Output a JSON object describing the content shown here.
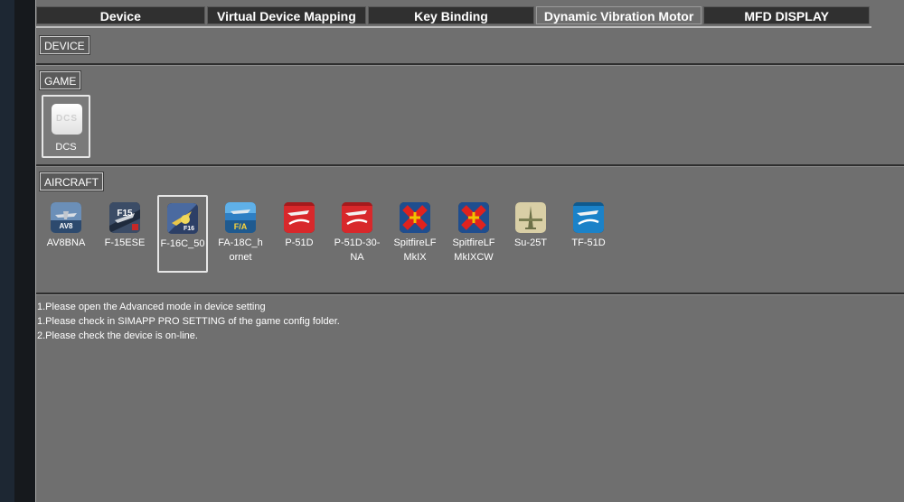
{
  "tabs": [
    {
      "label": "Device",
      "active": false
    },
    {
      "label": "Virtual Device Mapping",
      "active": false
    },
    {
      "label": "Key Binding",
      "active": false
    },
    {
      "label": "Dynamic Vibration Motor",
      "active": true
    },
    {
      "label": "MFD DISPLAY",
      "active": false
    }
  ],
  "sections": {
    "device": "DEVICE",
    "game": "GAME",
    "aircraft": "AIRCRAFT"
  },
  "game": {
    "label": "DCS",
    "icon": "dcs-logo-icon",
    "icon_text": "DCS"
  },
  "aircraft": [
    {
      "label": "AV8BNA",
      "icon": "av8bna-icon",
      "selected": false
    },
    {
      "label": "F-15ESE",
      "icon": "f15ese-icon",
      "selected": false
    },
    {
      "label": "F-16C_50",
      "icon": "f16c-icon",
      "selected": true
    },
    {
      "label": "FA-18C_hornet",
      "icon": "fa18c-icon",
      "selected": false
    },
    {
      "label": "P-51D",
      "icon": "p51d-icon",
      "selected": false
    },
    {
      "label": "P-51D-30-NA",
      "icon": "p51d30na-icon",
      "selected": false
    },
    {
      "label": "SpitfireLFMkIX",
      "icon": "spitfire-icon",
      "selected": false
    },
    {
      "label": "SpitfireLFMkIXCW",
      "icon": "spitfire-cw-icon",
      "selected": false
    },
    {
      "label": "Su-25T",
      "icon": "su25t-icon",
      "selected": false
    },
    {
      "label": "TF-51D",
      "icon": "tf51d-icon",
      "selected": false
    }
  ],
  "messages": [
    "1.Please open the Advanced mode in device setting",
    "1.Please check in SIMAPP PRO SETTING of the game config folder.",
    "2.Please check the device is on-line."
  ],
  "colors": {
    "panel": "#6f6f6f",
    "tab_bg": "#303030",
    "tab_active": "#6d6d6d",
    "mustang_red": "#d8282b",
    "spitfire_blue": "#1f4e8f",
    "cross_red": "#e0221e",
    "tf51_blue": "#1b82c8"
  }
}
